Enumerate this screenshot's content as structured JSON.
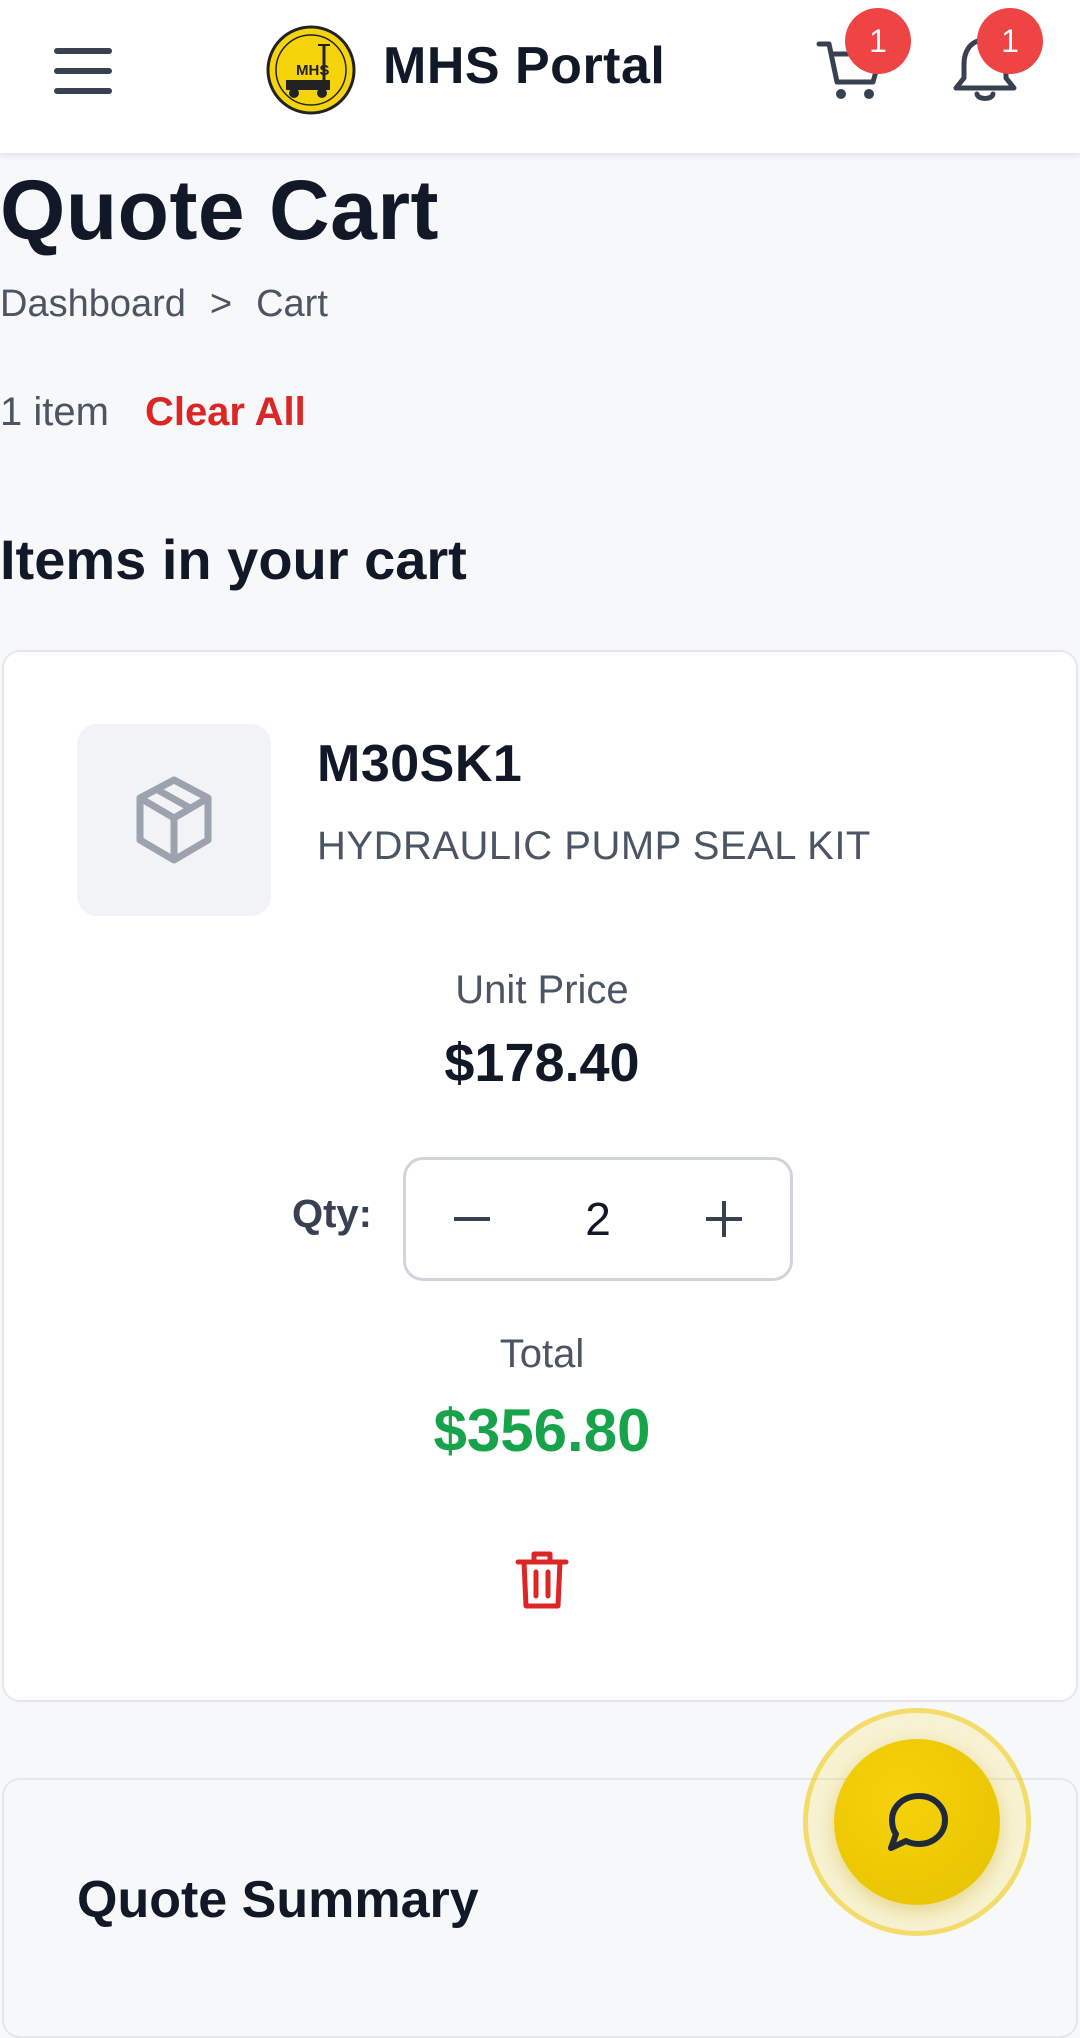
{
  "header": {
    "title": "MHS Portal",
    "logo_text": "MHS",
    "cart_badge": "1",
    "notification_badge": "1"
  },
  "page": {
    "title": "Quote Cart",
    "breadcrumb": [
      "Dashboard",
      ">",
      "Cart"
    ],
    "item_count": "1 item",
    "clear_all": "Clear All",
    "section_title": "Items in your cart"
  },
  "cart_items": [
    {
      "part_number": "M30SK1",
      "description": "HYDRAULIC PUMP SEAL KIT",
      "unit_price_label": "Unit Price",
      "unit_price": "$178.40",
      "qty_label": "Qty:",
      "quantity": "2",
      "total_label": "Total",
      "total": "$356.80"
    }
  ],
  "summary": {
    "title": "Quote Summary"
  },
  "colors": {
    "accent_yellow": "#f5d20a",
    "badge_red": "#ef4444",
    "danger_red": "#dc2626",
    "total_green": "#16a34a"
  },
  "icons": [
    "menu-icon",
    "logo",
    "cart-icon",
    "bell-icon",
    "package-icon",
    "minus-icon",
    "plus-icon",
    "trash-icon",
    "chat-icon"
  ]
}
